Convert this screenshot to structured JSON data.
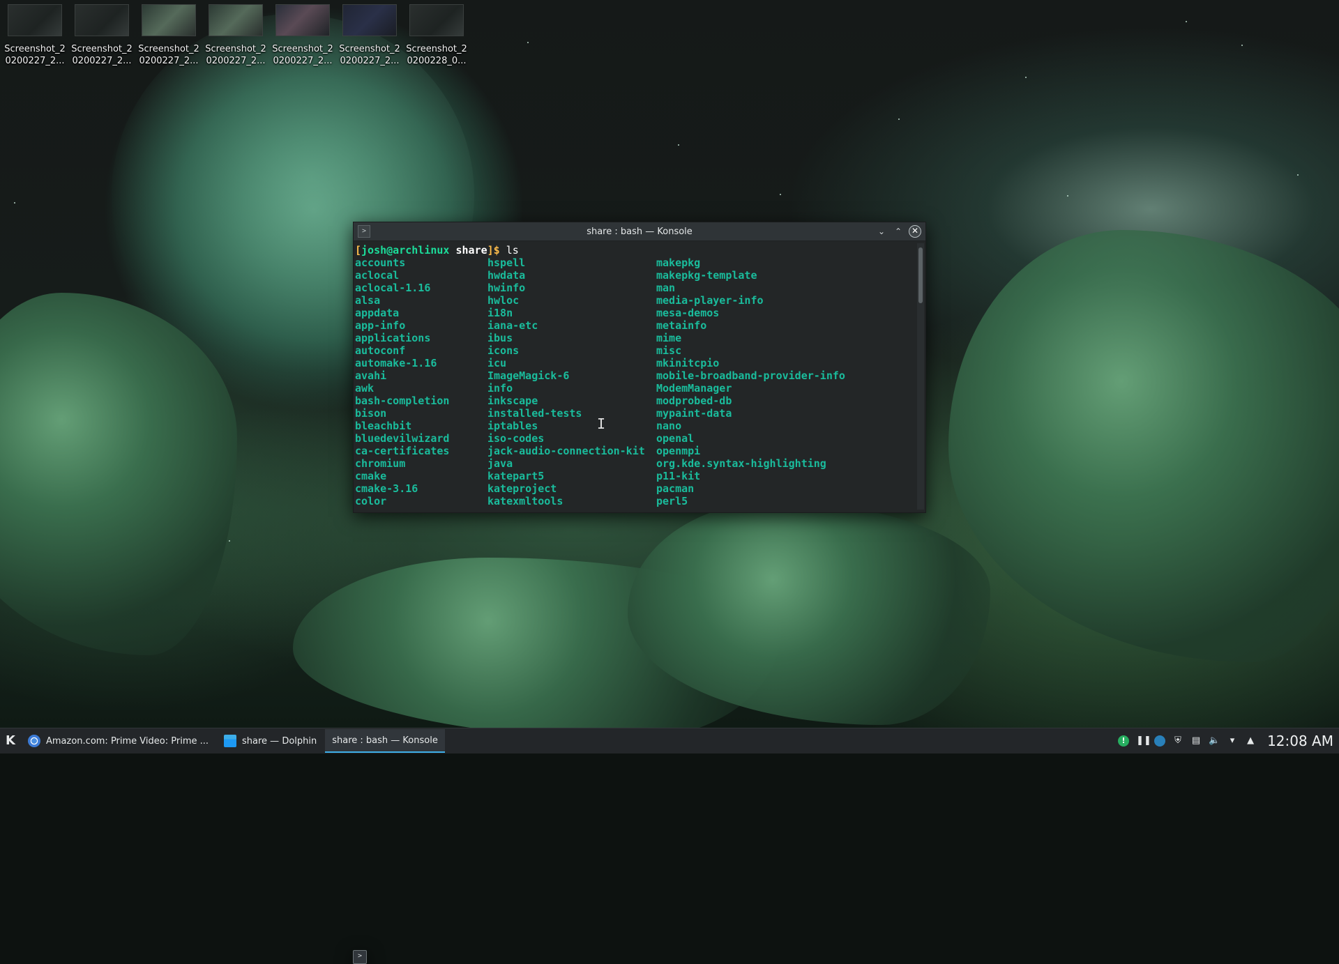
{
  "desktop": {
    "icons": [
      {
        "label": "Screenshot_2 0200227_2..."
      },
      {
        "label": "Screenshot_2 0200227_2..."
      },
      {
        "label": "Screenshot_2 0200227_2..."
      },
      {
        "label": "Screenshot_2 0200227_2..."
      },
      {
        "label": "Screenshot_2 0200227_2..."
      },
      {
        "label": "Screenshot_2 0200227_2..."
      },
      {
        "label": "Screenshot_2 0200228_0..."
      }
    ]
  },
  "konsole": {
    "title": "share : bash — Konsole",
    "prompt": {
      "open": "[",
      "user_host": "josh@archlinux",
      "dir": "share",
      "close": "]$ ",
      "command": "ls"
    },
    "columns": [
      [
        "accounts",
        "aclocal",
        "aclocal-1.16",
        "alsa",
        "appdata",
        "app-info",
        "applications",
        "autoconf",
        "automake-1.16",
        "avahi",
        "awk",
        "bash-completion",
        "bison",
        "bleachbit",
        "bluedevilwizard",
        "ca-certificates",
        "chromium",
        "cmake",
        "cmake-3.16",
        "color"
      ],
      [
        "hspell",
        "hwdata",
        "hwinfo",
        "hwloc",
        "i18n",
        "iana-etc",
        "ibus",
        "icons",
        "icu",
        "ImageMagick-6",
        "info",
        "inkscape",
        "installed-tests",
        "iptables",
        "iso-codes",
        "jack-audio-connection-kit",
        "java",
        "katepart5",
        "kateproject",
        "katexmltools"
      ],
      [
        "makepkg",
        "makepkg-template",
        "man",
        "media-player-info",
        "mesa-demos",
        "metainfo",
        "mime",
        "misc",
        "mkinitcpio",
        "mobile-broadband-provider-info",
        "ModemManager",
        "modprobed-db",
        "mypaint-data",
        "nano",
        "openal",
        "openmpi",
        "org.kde.syntax-highlighting",
        "p11-kit",
        "pacman",
        "perl5"
      ]
    ]
  },
  "taskbar": {
    "tasks": [
      {
        "label": "Amazon.com: Prime Video: Prime ...",
        "icon": "chrome-icon"
      },
      {
        "label": "share — Dolphin",
        "icon": "dolphin-icon"
      },
      {
        "label": "share : bash — Konsole",
        "icon": "konsole-icon"
      }
    ],
    "clock": "12:08 AM"
  },
  "colors": {
    "terminal_bg": "#232627",
    "directory_color": "#1abc9c",
    "prompt_user": "#1cdc9a",
    "accent": "#3daee9"
  }
}
